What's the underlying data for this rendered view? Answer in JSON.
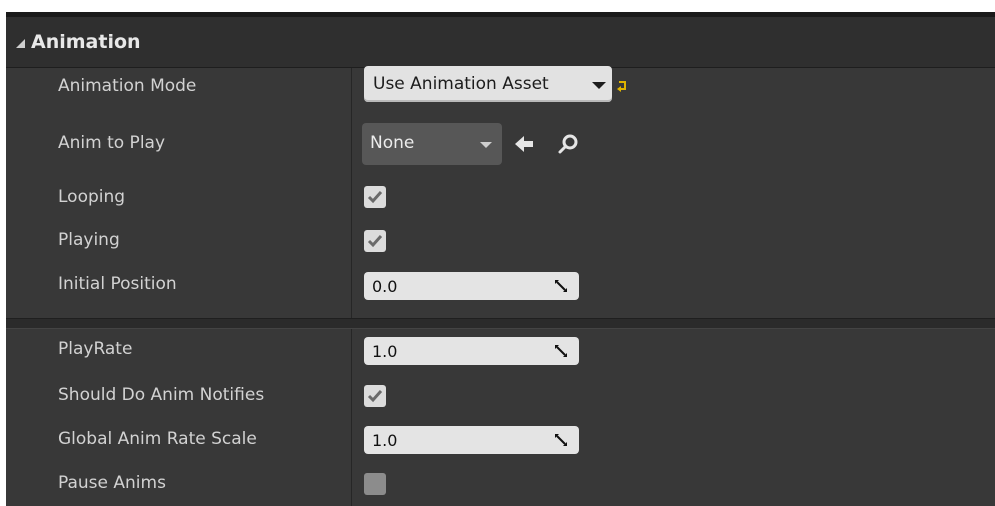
{
  "section": {
    "title": "Animation"
  },
  "rows": {
    "animation_mode": {
      "label": "Animation Mode",
      "value": "Use Animation Asset"
    },
    "anim_to_play": {
      "label": "Anim to Play",
      "value": "None"
    },
    "looping": {
      "label": "Looping",
      "checked": true
    },
    "playing": {
      "label": "Playing",
      "checked": true
    },
    "initial_position": {
      "label": "Initial Position",
      "value": "0.0"
    },
    "play_rate": {
      "label": "PlayRate",
      "value": "1.0"
    },
    "should_do_anim_notifies": {
      "label": "Should Do Anim Notifies",
      "checked": true
    },
    "global_anim_rate_scale": {
      "label": "Global Anim Rate Scale",
      "value": "1.0"
    },
    "pause_anims": {
      "label": "Pause Anims",
      "checked": false
    }
  },
  "icons": {
    "collapse": "collapse-triangle-icon",
    "reset": "reset-to-default-icon",
    "use_selected": "left-arrow-icon",
    "browse": "search-icon",
    "spin": "spin-drag-icon",
    "check": "checkmark-icon"
  },
  "colors": {
    "panel_bg": "#383838",
    "header_bg": "#2f2f2f",
    "reset_arrow": "#e0b400"
  }
}
